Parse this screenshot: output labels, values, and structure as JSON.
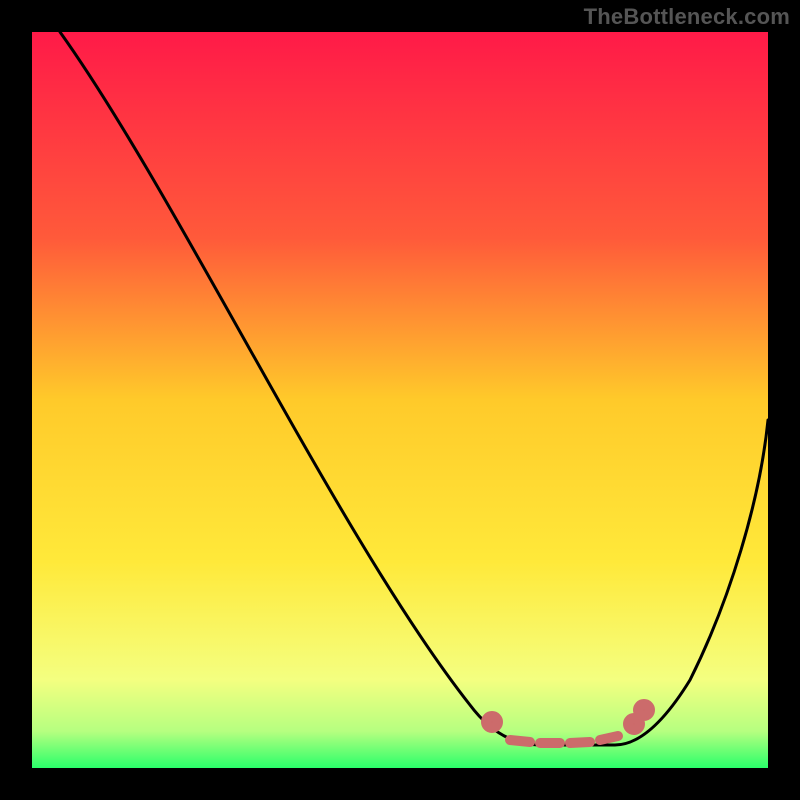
{
  "watermark": "TheBottleneck.com",
  "chart_data": {
    "type": "line",
    "title": "",
    "xlabel": "",
    "ylabel": "",
    "x_range": [
      0,
      100
    ],
    "y_range": [
      0,
      100
    ],
    "gradient": {
      "top": "#ff1a48",
      "upper_mid": "#ff8a2a",
      "mid": "#ffde2a",
      "lower": "#f7ff70",
      "bottom": "#2aff6a"
    },
    "curve_minimum_x": 70,
    "curve_left_top_x": 8,
    "curve_right_top_y": 55,
    "markers": {
      "color": "#cc6b6b",
      "left_x": 62,
      "right_x": 80,
      "y": 6
    }
  }
}
